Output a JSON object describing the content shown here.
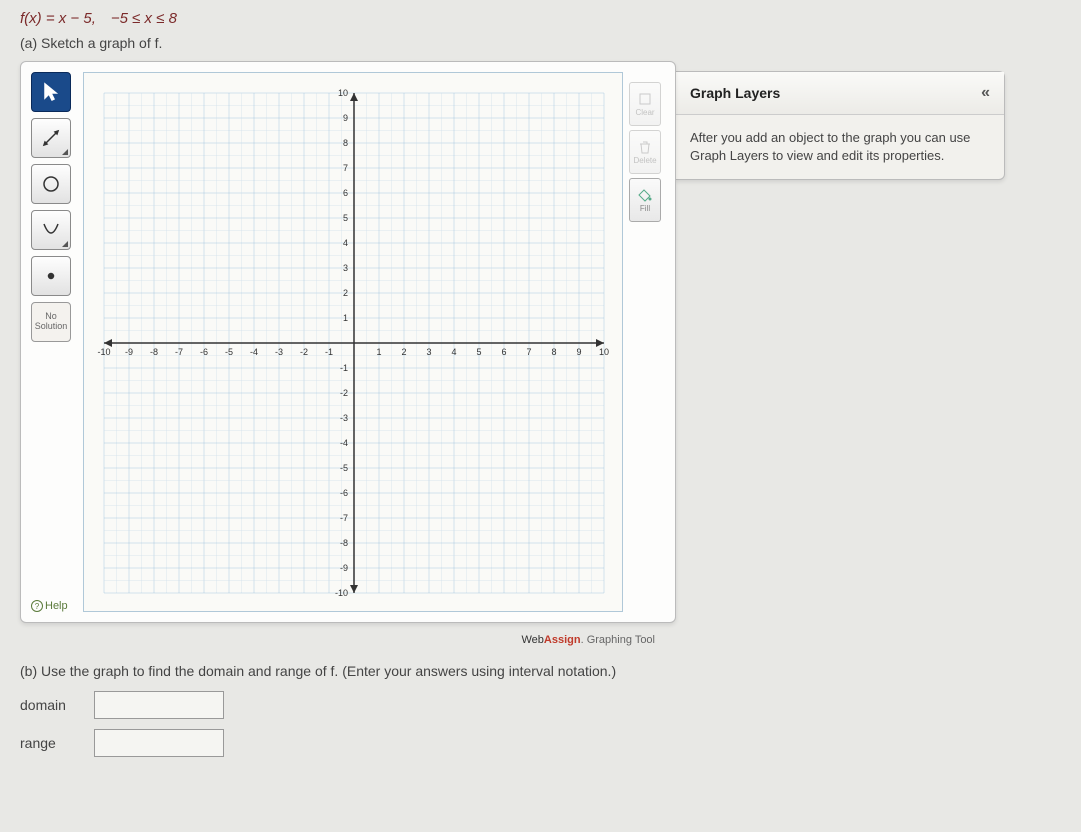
{
  "problem": {
    "formula": "f(x) = x − 5, −5 ≤ x ≤ 8",
    "part_a": "(a) Sketch a graph of f.",
    "part_b": "(b) Use the graph to find the domain and range of f. (Enter your answers using interval notation.)",
    "domain_label": "domain",
    "range_label": "range",
    "domain_value": "",
    "range_value": ""
  },
  "toolbar": {
    "no_solution": "No Solution",
    "help": "Help"
  },
  "right_tools": {
    "clear": "Clear",
    "delete": "Delete",
    "fill": "Fill"
  },
  "layers": {
    "title": "Graph Layers",
    "collapse": "«",
    "body": "After you add an object to the graph you can use Graph Layers to view and edit its properties."
  },
  "brand": {
    "web": "Web",
    "assign": "Assign",
    "suffix": ". Graphing Tool"
  },
  "grid": {
    "min": -10,
    "max": 10,
    "ticks_x_neg": [
      "-10",
      "-9",
      "-8",
      "-7",
      "-6",
      "-5",
      "-4",
      "-3",
      "-2",
      "-1"
    ],
    "ticks_x_pos": [
      "1",
      "2",
      "3",
      "4",
      "5",
      "6",
      "7",
      "8",
      "9",
      "10"
    ],
    "ticks_y_pos": [
      "1",
      "2",
      "3",
      "4",
      "5",
      "6",
      "7",
      "8",
      "9",
      "10"
    ],
    "ticks_y_neg": [
      "-1",
      "-2",
      "-3",
      "-4",
      "-5",
      "-6",
      "-7",
      "-8",
      "-9",
      "-10"
    ]
  }
}
